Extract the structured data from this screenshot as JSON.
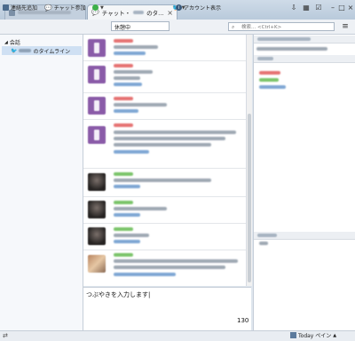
{
  "window": {
    "tabs": [
      {
        "label": ""
      },
      {
        "label": "チャット・",
        "suffix": "のタ…"
      }
    ],
    "tab_close": "×"
  },
  "toolbar": {
    "contacts_label": "連絡先追加",
    "chat_label": "チャット参加",
    "status_label": "休憩中",
    "account_label": "アカウント表示",
    "search_placeholder": "検索... <Ctrl+K>"
  },
  "sidebar": {
    "group_label": "会話",
    "items": [
      {
        "label": "のタイムライン"
      }
    ]
  },
  "compose": {
    "text": "つぶやきを入力します|",
    "counter": "130"
  },
  "statusbar": {
    "pane_label": "Today ペイン"
  },
  "colors": {
    "name_red": "#e57272",
    "name_green": "#7bc46a",
    "link_blue": "#7fa7d4",
    "twitter_blue": "#3a9be0"
  }
}
